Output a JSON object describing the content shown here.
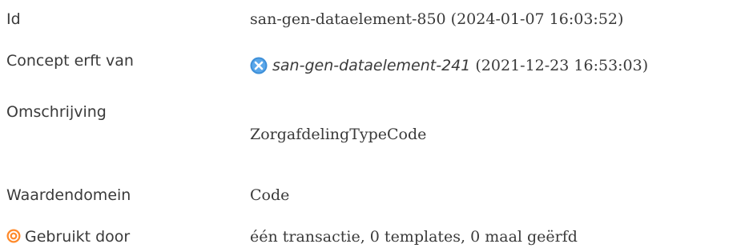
{
  "rows": {
    "id": {
      "label": "Id",
      "value": "san-gen-dataelement-850 (2024-01-07 16:03:52)"
    },
    "inherits": {
      "label": "Concept erft van",
      "link_text": "san-gen-dataelement-241",
      "suffix": " (2021-12-23 16:53:03)",
      "icon": "x-circle-icon"
    },
    "description": {
      "label": "Omschrijving",
      "value": "ZorgafdelingTypeCode"
    },
    "valuedomain": {
      "label": "Waardendomein",
      "value": "Code"
    },
    "used_by": {
      "label": "Gebruikt door",
      "value": "één transactie, 0 templates, 0 maal geërfd",
      "icon": "target-icon"
    }
  },
  "colors": {
    "text": "#3a3a3a",
    "x_icon": "#3d8fd8",
    "target_icon": "#ff8a2b"
  }
}
